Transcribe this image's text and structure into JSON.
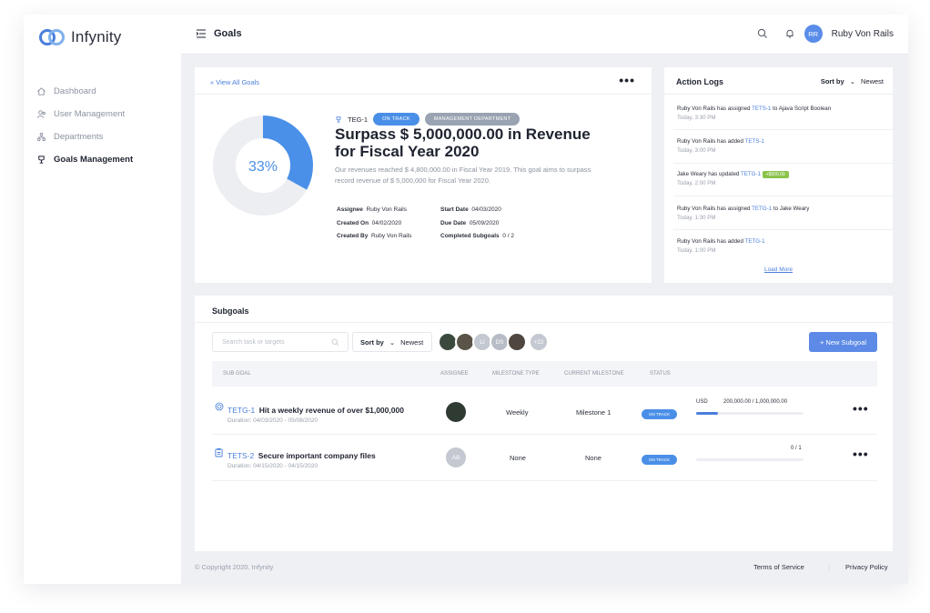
{
  "app": {
    "name": "Infynity"
  },
  "sidebar": {
    "items": [
      {
        "label": "Dashboard",
        "icon": "home-icon",
        "active": false
      },
      {
        "label": "User Management",
        "icon": "users-icon",
        "active": false
      },
      {
        "label": "Departments",
        "icon": "org-chart-icon",
        "active": false
      },
      {
        "label": "Goals Management",
        "icon": "trophy-icon",
        "active": true
      }
    ]
  },
  "topbar": {
    "title": "Goals",
    "user_initials": "RR",
    "user_name": "Ruby Von Rails"
  },
  "goal": {
    "back_link": "« View All Goals",
    "code": "TEG-1",
    "status": "ON TRACK",
    "department": "MANAGEMENT DEPARTMENT",
    "title": "Surpass $ 5,000,000.00 in Revenue for Fiscal Year 2020",
    "description": "Our revenues reached $ 4,800,000.00 in Fiscal Year 2019. This goal aims to surpass record revenue of $ 5,000,000 for Fiscal Year 2020.",
    "progress_label": "33%",
    "progress_fraction": 0.33,
    "meta": {
      "assignee_label": "Assignee",
      "assignee": "Ruby Von Rails",
      "created_on_label": "Created On",
      "created_on": "04/02/2020",
      "created_by_label": "Created By",
      "created_by": "Ruby Von Rails",
      "start_date_label": "Start Date",
      "start_date": "04/03/2020",
      "due_date_label": "Due Date",
      "due_date": "05/09/2020",
      "completed_label": "Completed Subgoals",
      "completed": "0 / 2"
    }
  },
  "logs": {
    "title": "Action Logs",
    "sort_label": "Sort by",
    "sort_value": "Newest",
    "entries": [
      {
        "pre": "Ruby Von Rails has assigned",
        "code": "TETS-1",
        "post": "to Ajava Script Boolean",
        "badge": "",
        "time": "Today, 3:30 PM"
      },
      {
        "pre": "Ruby Von Rails has added",
        "code": "TETS-1",
        "post": "",
        "badge": "",
        "time": "Today, 3:00 PM"
      },
      {
        "pre": "Jake Weary has updated",
        "code": "TETG-1",
        "post": "",
        "badge": "+$500.00",
        "time": "Today, 2:00 PM"
      },
      {
        "pre": "Ruby Von Rails has assigned",
        "code": "TETG-1",
        "post": "to Jake Weary",
        "badge": "",
        "time": "Today, 1:30 PM"
      },
      {
        "pre": "Ruby Von Rails has added",
        "code": "TETG-1",
        "post": "",
        "badge": "",
        "time": "Today, 1:00 PM"
      }
    ],
    "load_more": "Load More"
  },
  "subgoals": {
    "title": "Subgoals",
    "search_placeholder": "Search task or targets",
    "sort_label": "Sort by",
    "sort_value": "Newest",
    "avatars": [
      "",
      "",
      "LI",
      "DS",
      "",
      "+22"
    ],
    "new_button": "+ New Subgoal",
    "columns": [
      "SUB GOAL",
      "ASSIGNEE",
      "MILESTONE TYPE",
      "CURRENT MILESTONE",
      "STATUS"
    ],
    "rows": [
      {
        "code": "TETG-1",
        "name": "Hit a weekly revenue of over $1,000,000",
        "duration": "Duration: 04/03/2020 - 05/08/2020",
        "assignee": "",
        "milestone_type": "Weekly",
        "current_milestone": "Milestone 1",
        "status": "ON TRACK",
        "progress_prefix": "USD",
        "progress_text": "200,000.00 / 1,000,000.00",
        "progress_fraction": 0.2
      },
      {
        "code": "TETS-2",
        "name": "Secure important company files",
        "duration": "Duration: 04/15/2020 - 04/15/2020",
        "assignee": "AB",
        "milestone_type": "None",
        "current_milestone": "None",
        "status": "ON TRACK",
        "progress_prefix": "",
        "progress_text": "0 / 1",
        "progress_fraction": 0
      }
    ]
  },
  "footer": {
    "copyright": "© Copyright 2020. Infynity",
    "terms": "Terms of Service",
    "privacy": "Privacy Policy"
  },
  "colors": {
    "accent": "#4a7fdc",
    "status_blue": "#4a8fe7",
    "dept_gray": "#9aa3b2",
    "money_green": "#8bc34a",
    "button_blue": "#5d8ae6"
  }
}
